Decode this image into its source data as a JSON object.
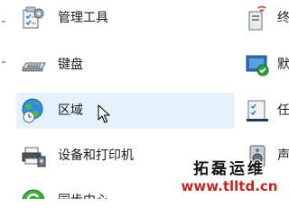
{
  "left_items": [
    {
      "label": "管理工具",
      "icon": "admin-tools-icon"
    },
    {
      "label": "键盘",
      "icon": "keyboard-icon"
    },
    {
      "label": "区域",
      "icon": "region-globe-icon"
    },
    {
      "label": "设备和打印机",
      "icon": "devices-printers-icon"
    },
    {
      "label": "同步中心",
      "icon": "sync-center-icon"
    }
  ],
  "right_items": [
    {
      "label": "终",
      "icon": "network-icon"
    },
    {
      "label": "默",
      "icon": "default-programs-icon"
    },
    {
      "label": "任",
      "icon": "taskbar-icon"
    },
    {
      "label": "声",
      "icon": "sound-icon"
    }
  ],
  "watermark": {
    "title": "拓磊运维",
    "url": "www.tlltd.cn"
  },
  "colors": {
    "hover_background": "#e5f1fb",
    "watermark_url": "#c0281e"
  }
}
